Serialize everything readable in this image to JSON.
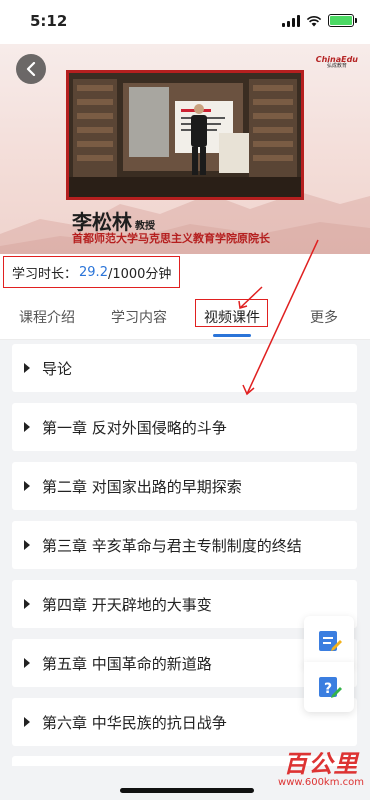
{
  "status_bar": {
    "time": "5:12"
  },
  "hero": {
    "brand_logo": "ChinaEdu",
    "brand_sub": "弘成教育",
    "lecturer_name": "李松林",
    "lecturer_rank": "教授",
    "lecturer_affiliation": "首都师范大学马克思主义教育学院原院长"
  },
  "study": {
    "label": "学习时长：",
    "value": "29.2",
    "total": "/1000分钟"
  },
  "tabs": [
    {
      "label": "课程介绍"
    },
    {
      "label": "学习内容"
    },
    {
      "label": "视频课件"
    },
    {
      "label": "更多"
    }
  ],
  "chapters": [
    {
      "label": "导论"
    },
    {
      "label": "第一章  反对外国侵略的斗争"
    },
    {
      "label": "第二章  对国家出路的早期探索"
    },
    {
      "label": "第三章  辛亥革命与君主专制制度的终结"
    },
    {
      "label": "第四章  开天辟地的大事变"
    },
    {
      "label": "第五章  中国革命的新道路"
    },
    {
      "label": "第六章  中华民族的抗日战争"
    }
  ],
  "watermark": {
    "main": "百公里",
    "url": "www.600km.com"
  },
  "colors": {
    "accent": "#2a74d8",
    "annotation": "#e02020",
    "brand": "#b51f1f"
  }
}
